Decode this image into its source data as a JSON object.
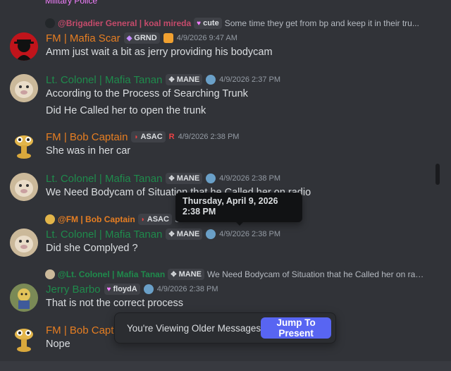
{
  "top_cut": "Military Police",
  "replies": [
    {
      "name": "@Brigadier General | koal mireda",
      "badge": "cute",
      "text": "Some time they get from bp and keep it in their tru..."
    },
    {
      "name": "@FM | Bob Captain",
      "badge": "ASAC",
      "text": "S..."
    },
    {
      "name": "@Lt. Colonel | Mafia Tanan",
      "badge": "MANE",
      "text": "We Need Bodycam of Situation that he Called her on radi..."
    }
  ],
  "messages": [
    {
      "name": "FM | Mafia Scar",
      "tag": "GRND",
      "time": "4/9/2026 9:47 AM",
      "lines": [
        "Amm just wait a bit as jerry providing his bodycam"
      ]
    },
    {
      "name": "Lt. Colonel | Mafia Tanan",
      "tag": "MANE",
      "time": "4/9/2026 2:37 PM",
      "lines": [
        "According to the Process of Searching Trunk",
        "Did He Called her to open the trunk"
      ]
    },
    {
      "name": "FM | Bob Captain",
      "tag": "ASAC",
      "time": "4/9/2026 2:38 PM",
      "extra": "R",
      "lines": [
        "She was in her car"
      ]
    },
    {
      "name": "Lt. Colonel | Mafia Tanan",
      "tag": "MANE",
      "time": "4/9/2026 2:38 PM",
      "lines": [
        "We Need Bodycam of Situation that he Called her on radio"
      ]
    },
    {
      "name": "Lt. Colonel | Mafia Tanan",
      "tag": "MANE",
      "time": "4/9/2026 2:38 PM",
      "lines": [
        "Did she Complyed ?"
      ]
    },
    {
      "name": "Jerry Barbo",
      "tag": "floydA",
      "time": "4/9/2026 2:38 PM",
      "lines": [
        "That is not the correct process"
      ]
    },
    {
      "name": "FM | Bob Captain",
      "lines": [
        "Nope"
      ]
    }
  ],
  "tooltip": {
    "text": "Thursday, April 9, 2026 2:38 PM"
  },
  "banner": {
    "text": "You're Viewing Older Messages",
    "button": "Jump To Present"
  },
  "colors": {
    "scar": "#e67e22",
    "tanan": "#1f8b4c",
    "bob": "#e67e22",
    "jerry": "#1f8b4c",
    "accent": "#5865f2"
  }
}
